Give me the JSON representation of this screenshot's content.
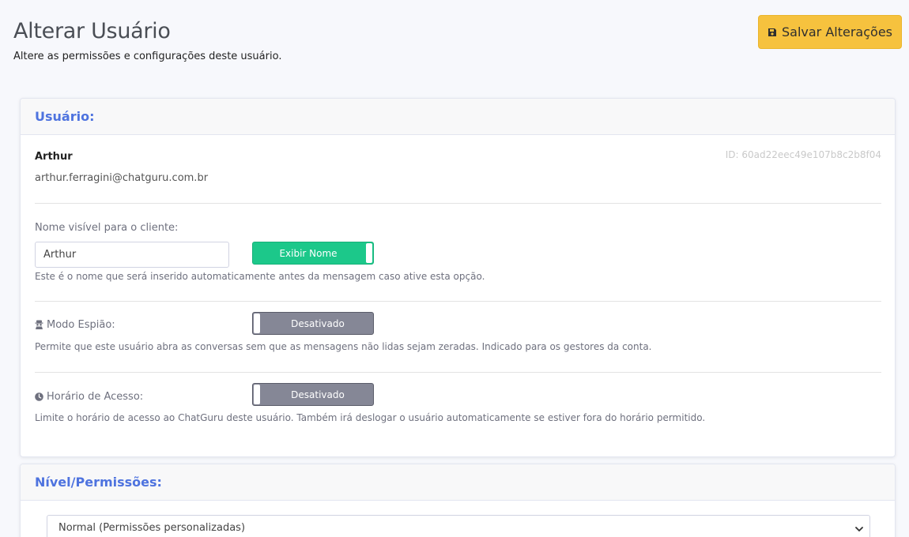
{
  "header": {
    "title": "Alterar Usuário",
    "subtitle": "Altere as permissões e configurações deste usuário.",
    "save_label": "Salvar Alterações"
  },
  "user_card": {
    "title": "Usuário:",
    "name": "Arthur",
    "email": "arthur.ferragini@chatguru.com.br",
    "id_text": "ID: 60ad22eec49e107b8c2b8f04",
    "visible_name": {
      "label": "Nome visível para o cliente:",
      "value": "Arthur",
      "toggle_label": "Exibir Nome",
      "toggle_on": true,
      "help": "Este é o nome que será inserido automaticamente antes da mensagem caso ative esta opção."
    },
    "spy_mode": {
      "label": "Modo Espião:",
      "icon": "user-secret-icon",
      "toggle_label": "Desativado",
      "toggle_on": false,
      "help": "Permite que este usuário abra as conversas sem que as mensagens não lidas sejam zeradas. Indicado para os gestores da conta."
    },
    "access_hours": {
      "label": "Horário de Acesso:",
      "icon": "clock-icon",
      "toggle_label": "Desativado",
      "toggle_on": false,
      "help": "Limite o horário de acesso ao ChatGuru deste usuário. Também irá deslogar o usuário automaticamente se estiver fora do horário permitido."
    }
  },
  "permissions_card": {
    "title": "Nível/Permissões:",
    "selected_level": "Normal (Permissões personalizadas)"
  },
  "colors": {
    "accent": "#4e73df",
    "warning": "#f6c23e",
    "success": "#1cc88a",
    "secondary": "#858796"
  }
}
